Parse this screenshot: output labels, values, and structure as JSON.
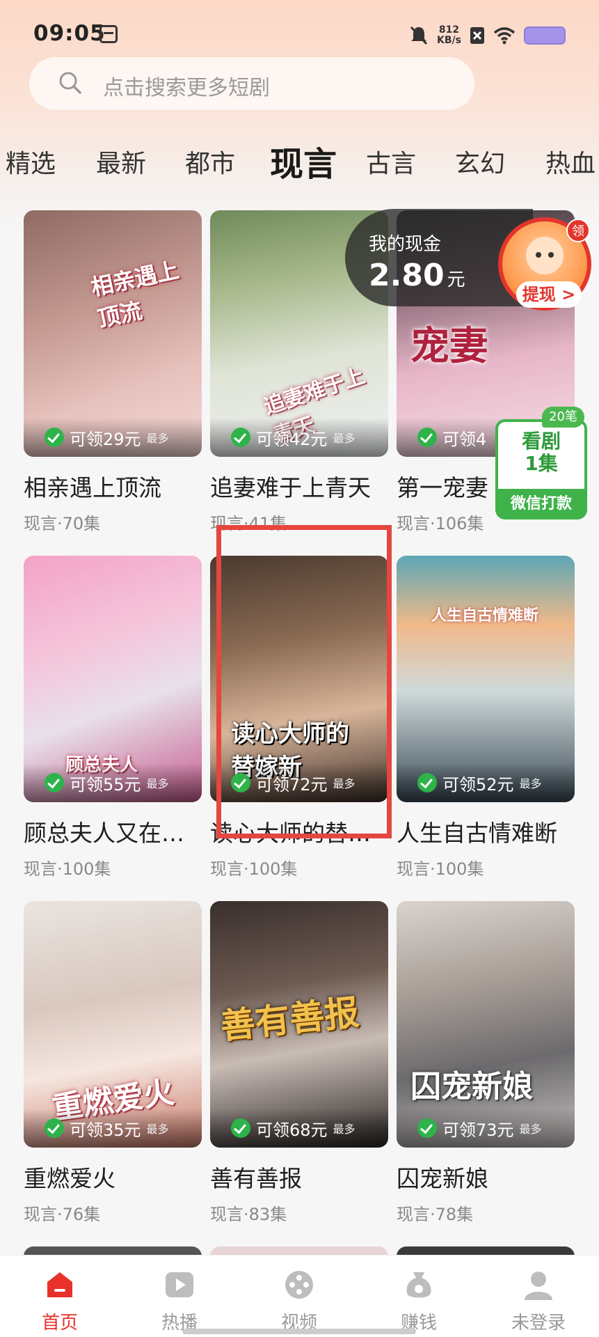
{
  "status_bar": {
    "time": "09:05",
    "net_speed_value": "812",
    "net_speed_unit": "KB/s",
    "battery_color": "#a493e8"
  },
  "search": {
    "placeholder": "点击搜索更多短剧"
  },
  "tabs": [
    {
      "label": "精选"
    },
    {
      "label": "最新"
    },
    {
      "label": "都市"
    },
    {
      "label": "现言",
      "active": true
    },
    {
      "label": "古言"
    },
    {
      "label": "玄幻"
    },
    {
      "label": "热血"
    }
  ],
  "cash": {
    "label": "我的现金",
    "amount": "2.80",
    "unit": "元",
    "badge": "领",
    "withdraw": "提现 >"
  },
  "watch_promo": {
    "badge": "20笔",
    "line1": "看剧",
    "line2": "1集",
    "pay": "微信打款"
  },
  "reward_max_label": "最多",
  "cards": [
    {
      "title": "相亲遇上顶流",
      "meta": "现言·70集",
      "reward": "可领29元",
      "poster_text": "相亲遇上顶流"
    },
    {
      "title": "追妻难于上青天",
      "meta": "现言·41集",
      "reward": "可领42元",
      "poster_text": "追妻难于上青天"
    },
    {
      "title": "第一宠妻",
      "meta": "现言·106集",
      "reward": "可领4",
      "poster_text": "宠妻"
    },
    {
      "title": "顾总夫人又在…",
      "meta": "现言·100集",
      "reward": "可领55元",
      "poster_text": "顾总夫人"
    },
    {
      "title": "读心大师的替…",
      "meta": "现言·100集",
      "reward": "可领72元",
      "poster_text": "读心大师的替嫁新"
    },
    {
      "title": "人生自古情难断",
      "meta": "现言·100集",
      "reward": "可领52元",
      "poster_text": "人生自古情难断"
    },
    {
      "title": "重燃爱火",
      "meta": "现言·76集",
      "reward": "可领35元",
      "poster_text": "重燃爱火"
    },
    {
      "title": "善有善报",
      "meta": "现言·83集",
      "reward": "可领68元",
      "poster_text": "善有善报"
    },
    {
      "title": "囚宠新娘",
      "meta": "现言·78集",
      "reward": "可领73元",
      "poster_text": "囚宠新娘"
    }
  ],
  "nav": [
    {
      "label": "首页",
      "icon": "home-icon",
      "active": true
    },
    {
      "label": "热播",
      "icon": "play-icon"
    },
    {
      "label": "视频",
      "icon": "film-reel-icon"
    },
    {
      "label": "赚钱",
      "icon": "money-bag-icon"
    },
    {
      "label": "未登录",
      "icon": "user-icon"
    }
  ],
  "colors": {
    "accent": "#e8312b",
    "reward_green": "#2db34a",
    "highlight": "#e5463f"
  }
}
